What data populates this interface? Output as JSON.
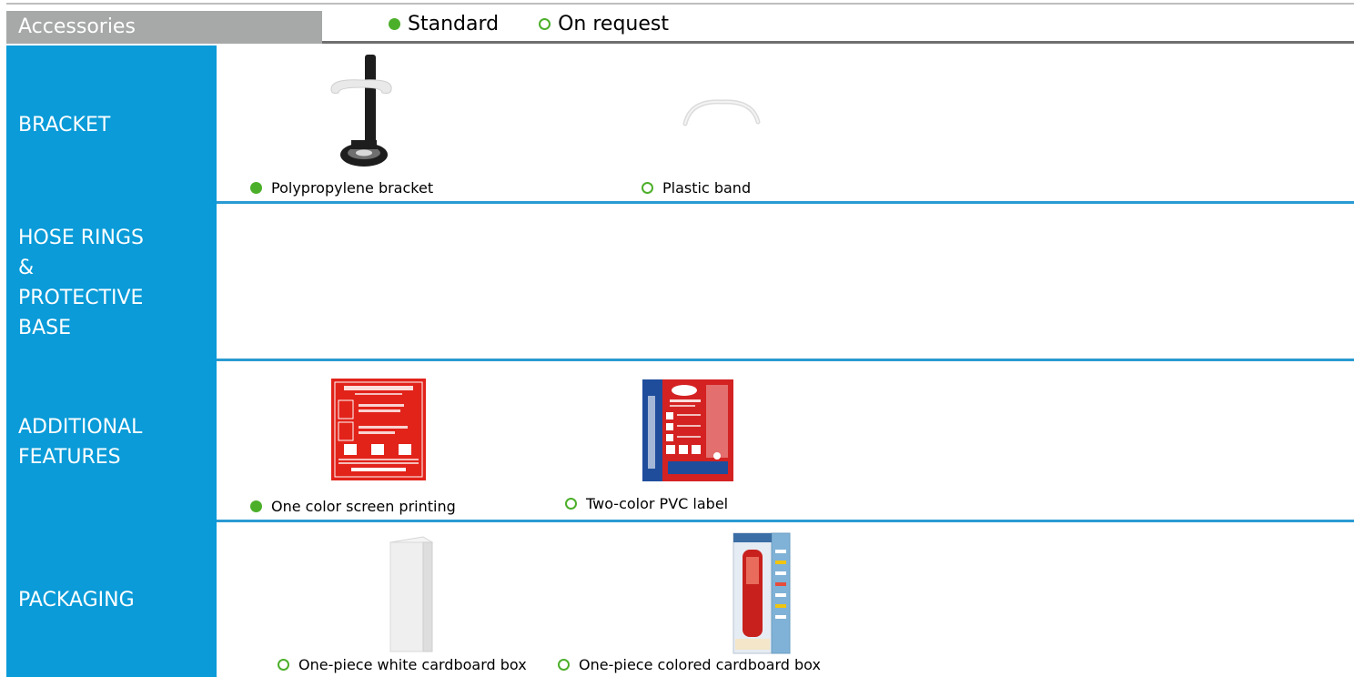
{
  "header": {
    "title": "Accessories",
    "standard_label": "Standard",
    "on_request_label": "On request"
  },
  "rows": [
    {
      "label": "BRACKET",
      "items": [
        {
          "caption": "Polypropylene bracket",
          "type": "standard",
          "icon": "bracket-image"
        },
        {
          "caption": "Plastic band",
          "type": "on-request",
          "icon": "plastic-band-image"
        }
      ]
    },
    {
      "label": "HOSE RINGS & PROTECTIVE BASE",
      "label_lines": [
        "HOSE RINGS",
        "&",
        "PROTECTIVE",
        "BASE"
      ],
      "items": []
    },
    {
      "label": "ADDITIONAL FEATURES",
      "label_lines": [
        "ADDITIONAL",
        "FEATURES"
      ],
      "items": [
        {
          "caption": "One color screen printing",
          "type": "standard",
          "icon": "screen-print-label-image"
        },
        {
          "caption": "Two-color PVC label",
          "type": "on-request",
          "icon": "pvc-label-image"
        }
      ]
    },
    {
      "label": "PACKAGING",
      "items": [
        {
          "caption": "One-piece white cardboard box",
          "type": "on-request",
          "icon": "white-box-image"
        },
        {
          "caption": "One-piece colored cardboard box",
          "type": "on-request",
          "icon": "colored-box-image"
        }
      ]
    }
  ],
  "colors": {
    "brand_blue": "#0a9bd8",
    "standard_green": "#4caf2a",
    "header_grey": "#a7a8a8"
  }
}
